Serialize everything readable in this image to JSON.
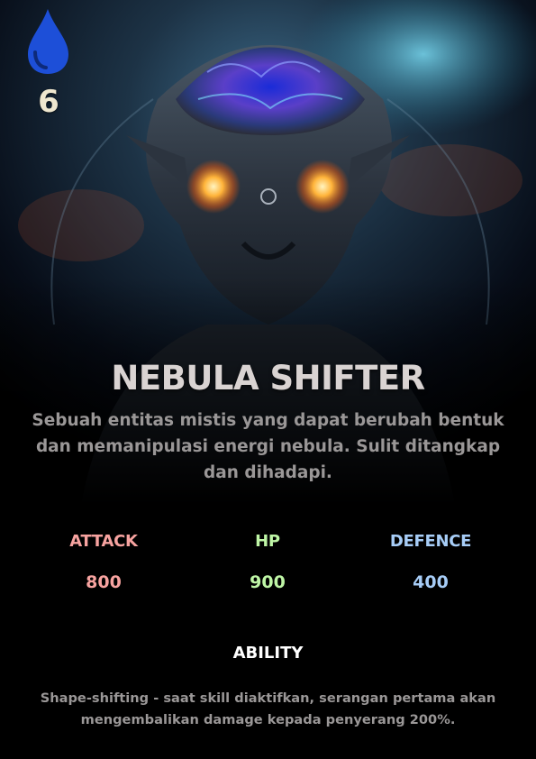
{
  "card": {
    "element_icon": "water-drop-icon",
    "cost": "6",
    "name": "NEBULA SHIFTER",
    "description": "Sebuah entitas mistis yang dapat berubah bentuk dan memanipulasi energi nebula. Sulit ditangkap dan dihadapi.",
    "stats": [
      {
        "label": "ATTACK",
        "value": "800",
        "color": "#f7a3a0"
      },
      {
        "label": "HP",
        "value": "900",
        "color": "#bff6a6"
      },
      {
        "label": "DEFENCE",
        "value": "400",
        "color": "#a7cdf7"
      }
    ],
    "ability": {
      "title": "ABILITY",
      "text": "Shape-shifting - saat skill diaktifkan, serangan pertama akan mengembalikan damage kepada penyerang 200%."
    }
  },
  "colors": {
    "background": "#000000",
    "drop": "#1d4fd8",
    "cost_text": "#efe7cf",
    "title": "#d9d3d2",
    "body_text": "#9a9797",
    "ability_title": "#ffffff"
  }
}
